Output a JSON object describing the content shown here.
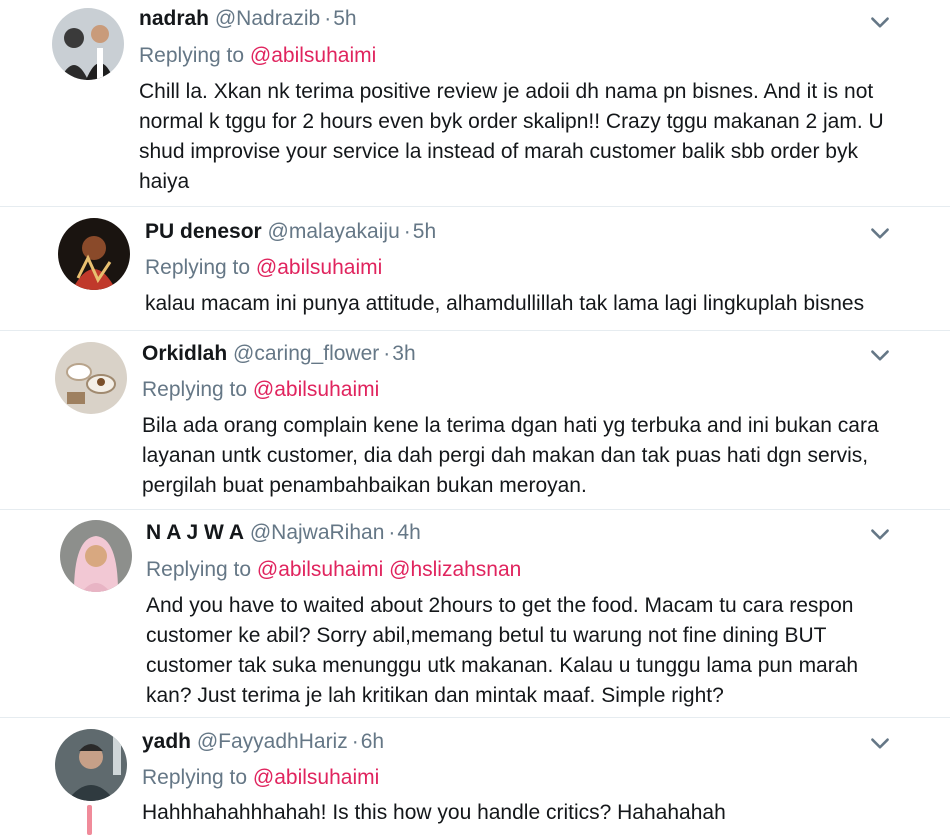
{
  "replies": [
    {
      "name": "nadrah",
      "handle": "@Nadrazib",
      "time": "5h",
      "replying_label": "Replying to",
      "mentions": [
        "@abilsuhaimi"
      ],
      "lines": [
        "Chill la. Xkan nk terima positive review je adoii dh nama pn bisnes. And it is not",
        "normal k tggu for 2 hours even byk order skalipn!! Crazy tggu makanan 2 jam. U",
        "shud improvise your service la instead of marah customer balik sbb order byk",
        "haiya"
      ]
    },
    {
      "name": "PU denesor",
      "handle": "@malayakaiju",
      "time": "5h",
      "replying_label": "Replying to",
      "mentions": [
        "@abilsuhaimi"
      ],
      "lines": [
        "kalau macam ini punya attitude, alhamdullillah tak lama lagi lingkuplah bisnes"
      ]
    },
    {
      "name": "Orkidlah",
      "handle": "@caring_flower",
      "time": "3h",
      "replying_label": "Replying to",
      "mentions": [
        "@abilsuhaimi"
      ],
      "lines": [
        "Bila ada orang complain kene la terima dgan hati yg terbuka and ini bukan cara",
        "layanan untk customer, dia dah pergi dah makan dan tak puas hati dgn servis,",
        "pergilah buat penambahbaikan bukan meroyan."
      ]
    },
    {
      "name": "N A J W A",
      "handle": "@NajwaRihan",
      "time": "4h",
      "replying_label": "Replying to",
      "mentions": [
        "@abilsuhaimi",
        "@hslizahsnan"
      ],
      "lines": [
        "And you have to waited about 2hours to get the food. Macam tu cara respon",
        "customer ke abil? Sorry abil,memang betul tu warung not fine dining BUT",
        "customer tak suka menunggu utk makanan. Kalau u tunggu lama pun marah",
        "kan? Just terima je lah kritikan dan mintak maaf. Simple right?"
      ]
    },
    {
      "name": "yadh",
      "handle": "@FayyadhHariz",
      "time": "6h",
      "replying_label": "Replying to",
      "mentions": [
        "@abilsuhaimi"
      ],
      "lines": [
        "Hahhhahahhhahah! Is this how you handle critics? Hahahahah"
      ]
    }
  ],
  "colors": {
    "mention": "#e0245e",
    "secondary_text": "#657786",
    "primary_text": "#14171a",
    "thread_line": "#f08b9a"
  },
  "icons": {
    "menu": "chevron-down-icon"
  }
}
